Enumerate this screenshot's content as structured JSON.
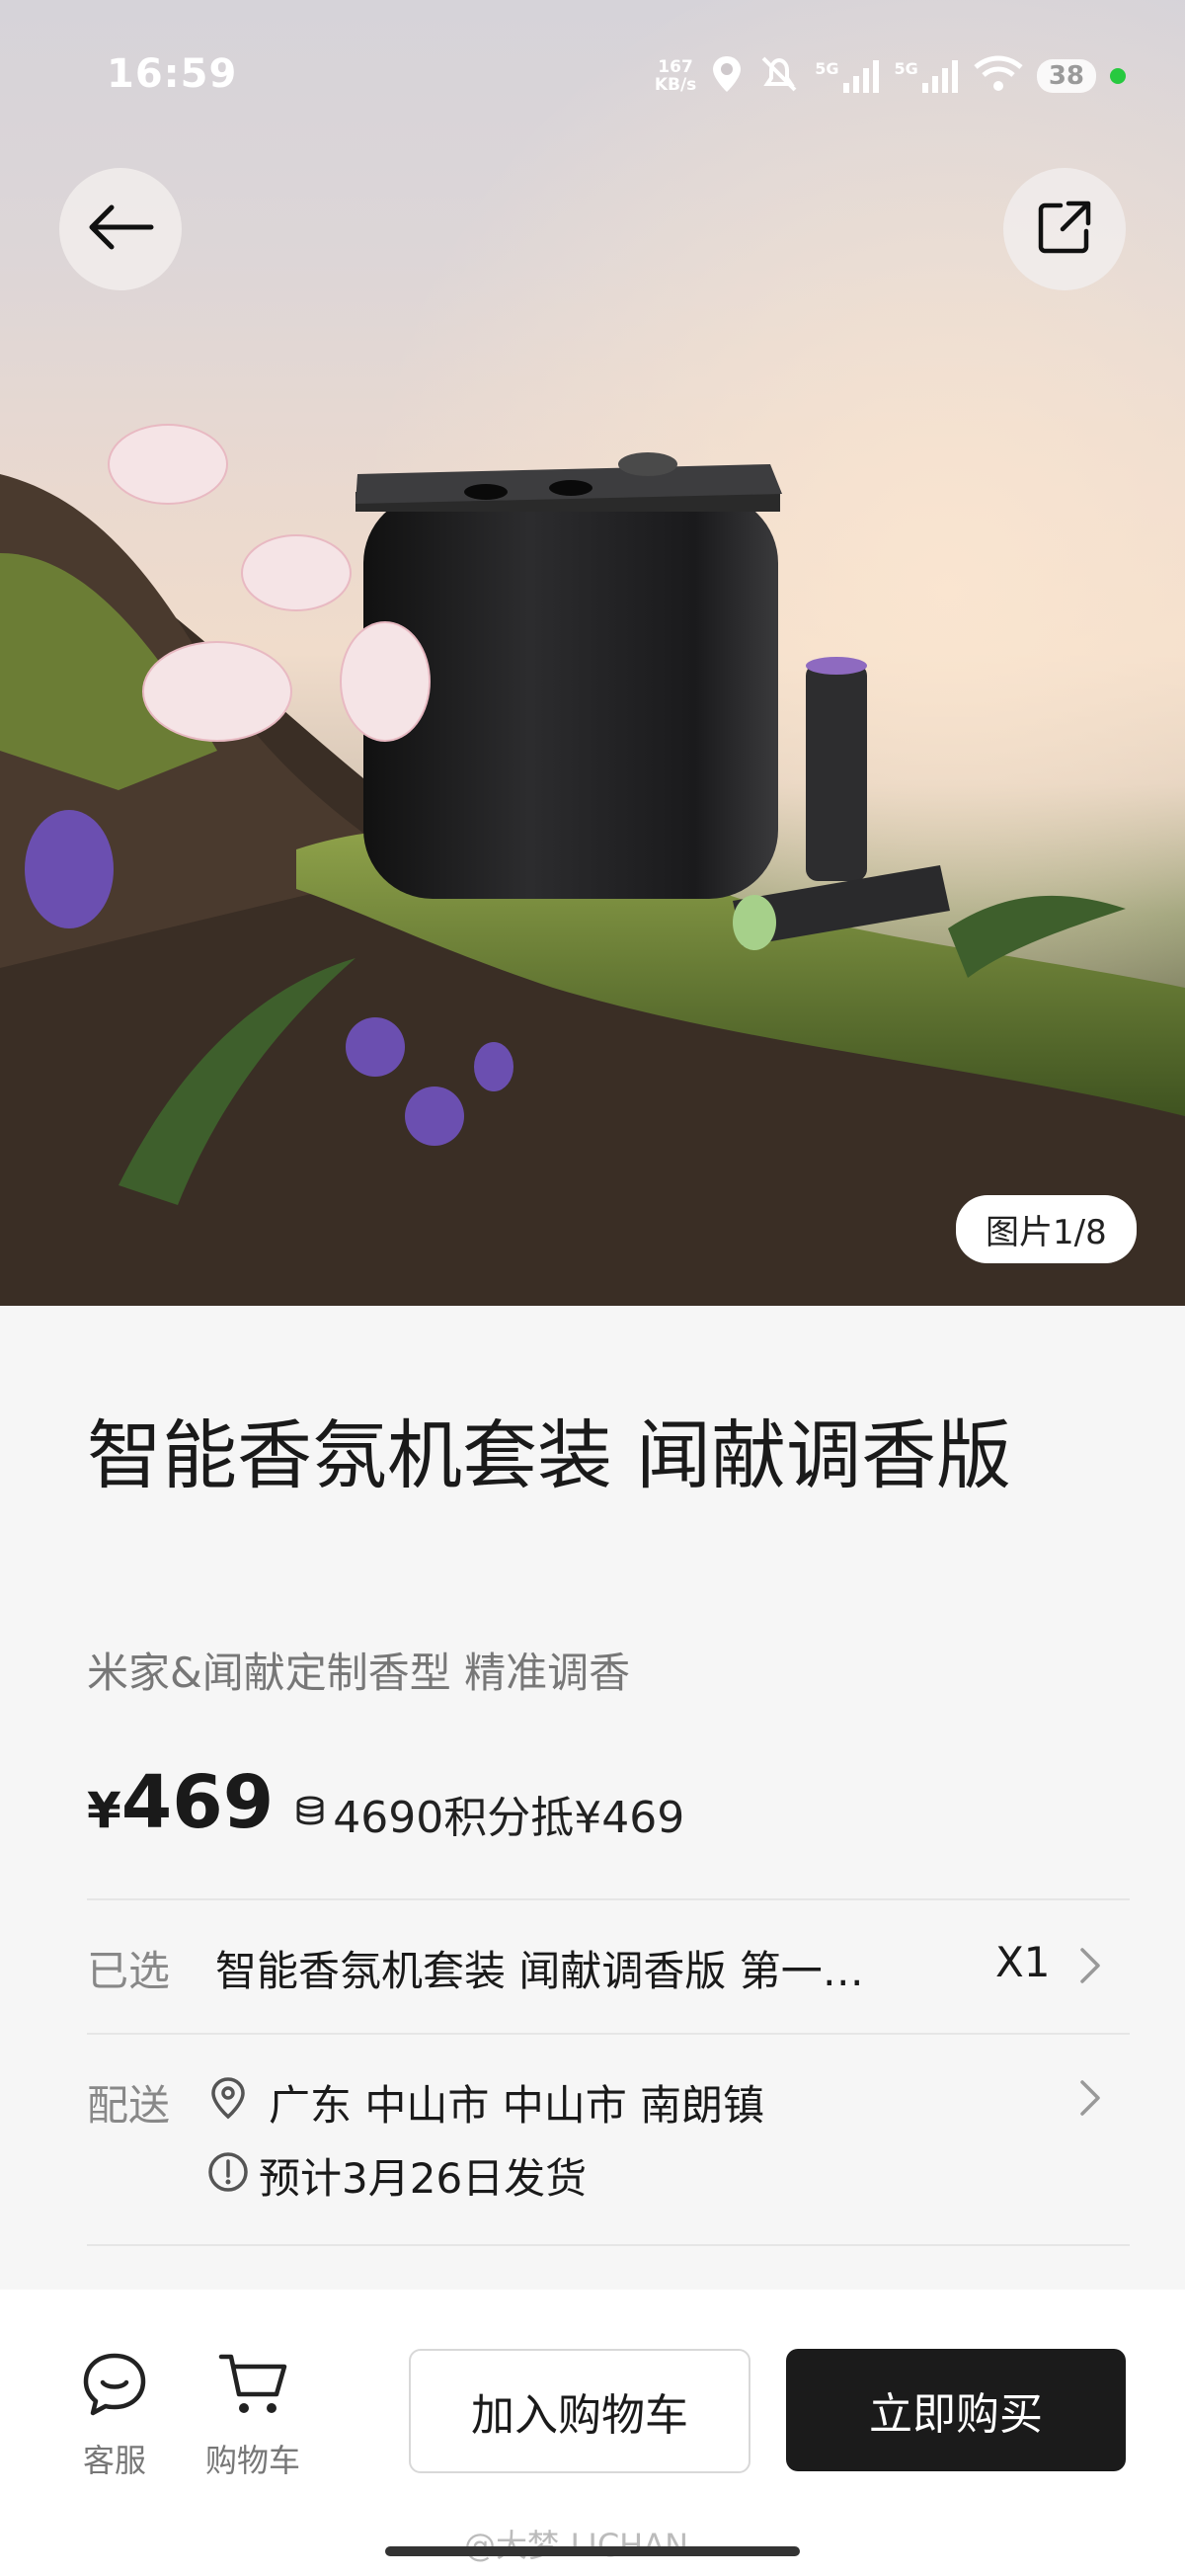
{
  "status_bar": {
    "time": "16:59",
    "net_speed_value": "167",
    "net_speed_unit": "KB/s",
    "signal_1": "5G",
    "signal_2": "5G",
    "battery": "38"
  },
  "hero": {
    "image_counter": "图片1/8"
  },
  "product": {
    "title": "智能香氛机套装 闻献调香版",
    "subtitle": "米家&闻献定制香型 精准调香",
    "price_symbol": "¥",
    "price": "469",
    "points_text": "4690积分抵¥469"
  },
  "selection": {
    "label": "已选",
    "value": "智能香氛机套装 闻献调香版  第一…",
    "quantity": "X1"
  },
  "delivery": {
    "label": "配送",
    "address": "广东 中山市 中山市 南朗镇",
    "ship_date": "预计3月26日发货"
  },
  "bottom_bar": {
    "service_label": "客服",
    "cart_label": "购物车",
    "add_to_cart": "加入购物车",
    "buy_now": "立即购买"
  },
  "watermark": "@大梦-LICHAN"
}
